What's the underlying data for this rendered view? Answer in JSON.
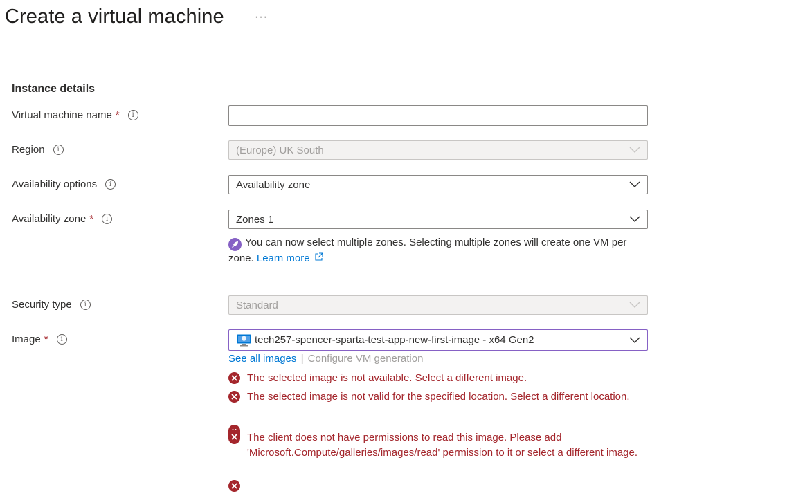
{
  "page": {
    "title": "Create a virtual machine",
    "more_label": "···"
  },
  "section": {
    "title": "Instance details"
  },
  "fields": {
    "vm_name": {
      "label": "Virtual machine name",
      "required": "*",
      "value": ""
    },
    "region": {
      "label": "Region",
      "value": "(Europe) UK South"
    },
    "availability_options": {
      "label": "Availability options",
      "value": "Availability zone"
    },
    "availability_zone": {
      "label": "Availability zone",
      "required": "*",
      "value": "Zones 1"
    },
    "security_type": {
      "label": "Security type",
      "value": "Standard"
    },
    "image": {
      "label": "Image",
      "required": "*",
      "value": "tech257-spencer-sparta-test-app-new-first-image - x64 Gen2"
    }
  },
  "zone_notice": {
    "text": "You can now select multiple zones. Selecting multiple zones will create one VM per zone.",
    "link": "Learn more"
  },
  "image_links": {
    "see_all": "See all images",
    "separator": "|",
    "configure": "Configure VM generation"
  },
  "errors": [
    "The selected image is not available. Select a different image.",
    "The selected image is not valid for the specified location. Select a different location.",
    "The client does not have permissions to read this image. Please add 'Microsoft.Compute/galleries/images/read' permission to it or select a different image.",
    ""
  ],
  "colors": {
    "error": "#a4262c",
    "link": "#0078d4",
    "accent": "#8661c5"
  }
}
